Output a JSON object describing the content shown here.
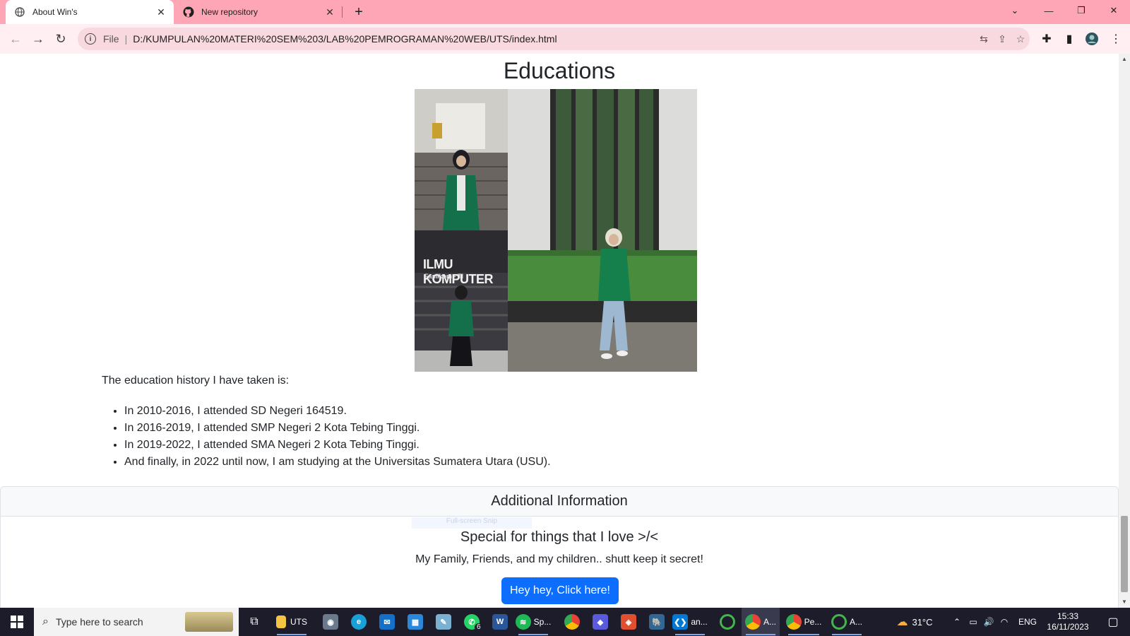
{
  "browser": {
    "tabs": [
      {
        "title": "About Win's",
        "active": true,
        "icon": "globe-icon"
      },
      {
        "title": "New repository",
        "active": false,
        "icon": "github-icon"
      }
    ],
    "new_tab": "+",
    "omnibox": {
      "file_label": "File",
      "separator": "|",
      "url": "D:/KUMPULAN%20MATERI%20SEM%203/LAB%20PEMROGRAMAN%20WEB/UTS/index.html"
    }
  },
  "page": {
    "education_title": "Educations",
    "intro": "The education history I have taken is:",
    "education_items": [
      "In 2010-2016, I attended SD Negeri 164519.",
      "In 2016-2019, I attended SMP Negeri 2 Kota Tebing Tinggi.",
      "In 2019-2022, I attended SMA Negeri 2 Kota Tebing Tinggi.",
      "And finally, in 2022 until now, I am studying at the Universitas Sumatera Utara (USU)."
    ],
    "collage_sign": {
      "line1": "ILMU KOMPUTER",
      "line2": "Fasilkom - TI"
    },
    "card": {
      "header": "Additional Information",
      "subtitle": "Special for things that I love >/<",
      "text": "My Family, Friends, and my children.. shutt keep it secret!",
      "button": "Hey hey, Click here!",
      "snip_hint": "Full-screen Snip"
    }
  },
  "taskbar": {
    "search_placeholder": "Type here to search",
    "apps": [
      {
        "label": "UTS",
        "icon": "folder-icon"
      },
      {
        "label": "",
        "icon": "camera-icon"
      },
      {
        "label": "",
        "icon": "edge-icon"
      },
      {
        "label": "",
        "icon": "mail-icon"
      },
      {
        "label": "",
        "icon": "store-icon"
      },
      {
        "label": "",
        "icon": "notes-icon"
      },
      {
        "label": "",
        "icon": "whatsapp-icon",
        "badge": "6"
      },
      {
        "label": "",
        "icon": "word-icon"
      },
      {
        "label": "Sp...",
        "icon": "spotify-icon"
      },
      {
        "label": "",
        "icon": "chrome-icon"
      },
      {
        "label": "",
        "icon": "app-icon"
      },
      {
        "label": "",
        "icon": "git-icon"
      },
      {
        "label": "",
        "icon": "postgres-icon"
      },
      {
        "label": "an...",
        "icon": "vscode-icon"
      },
      {
        "label": "",
        "icon": "anaconda-icon"
      },
      {
        "label": "A...",
        "icon": "chrome-icon"
      },
      {
        "label": "Pe...",
        "icon": "chrome-icon"
      },
      {
        "label": "A...",
        "icon": "anaconda-icon"
      }
    ],
    "weather": "31°C",
    "language": "ENG",
    "time": "15:33",
    "date": "16/11/2023"
  },
  "colors": {
    "tabstrip": "#ffa6b6",
    "toolbar": "#ffeef2",
    "primary_button": "#0d6efd",
    "taskbar": "#1c1c2b"
  }
}
